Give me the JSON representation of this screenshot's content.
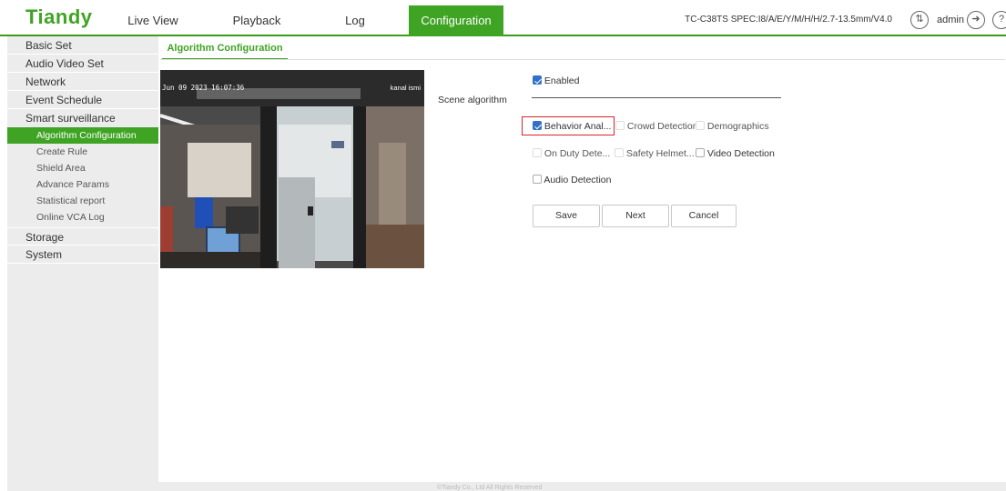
{
  "header": {
    "logo": "Tiandy",
    "nav": [
      "Live View",
      "Playback",
      "Log",
      "Configuration"
    ],
    "active_nav": "Configuration",
    "device_info": "TC-C38TS SPEC:I8/A/E/Y/M/H/H/2.7-13.5mm/V4.0",
    "user": "admin",
    "help_glyph": "?"
  },
  "sidebar": {
    "top_items": [
      "Basic Set",
      "Audio Video Set",
      "Network",
      "Event Schedule",
      "Smart surveillance"
    ],
    "sub_items": [
      "Algorithm Configuration",
      "Create Rule",
      "Shield Area",
      "Advance Params",
      "Statistical report",
      "Online VCA Log"
    ],
    "bottom_items": [
      "Storage",
      "System"
    ]
  },
  "tab": {
    "label": "Algorithm Configuration"
  },
  "video": {
    "timestamp": "Jun 09 2023 16:07:36",
    "channel_name": "kanal ismi"
  },
  "form": {
    "enabled_label": "Enabled",
    "scene_label": "Scene algorithm",
    "options": {
      "behavior": "Behavior Anal...",
      "crowd": "Crowd Detection",
      "demographics": "Demographics",
      "onduty": "On Duty Dete...",
      "helmet": "Safety Helmet...",
      "video_detection": "Video Detection",
      "audio_detection": "Audio Detection"
    },
    "buttons": {
      "save": "Save",
      "next": "Next",
      "cancel": "Cancel"
    }
  },
  "footer": {
    "copyright": "©Tiandy Co., Ltd All Rights Reserved"
  },
  "colors": {
    "brand_green": "#3fa423",
    "checkbox_blue": "#2f72c7",
    "highlight_red": "#d9232d"
  }
}
